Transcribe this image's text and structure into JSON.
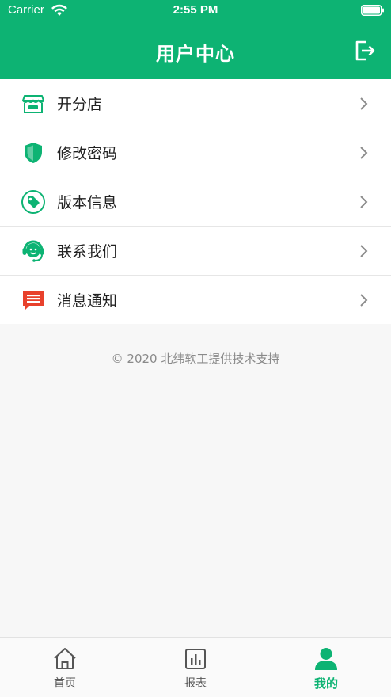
{
  "status_bar": {
    "carrier": "Carrier",
    "time": "2:55 PM"
  },
  "header": {
    "title": "用户中心",
    "bg_color": "#0db373",
    "logout_icon": "logout-icon"
  },
  "menu": {
    "items": [
      {
        "label": "开分店",
        "icon": "store-icon",
        "color": "#0db373"
      },
      {
        "label": "修改密码",
        "icon": "shield-icon",
        "color": "#0db373"
      },
      {
        "label": "版本信息",
        "icon": "tag-icon",
        "color": "#0db373"
      },
      {
        "label": "联系我们",
        "icon": "headset-icon",
        "color": "#0db373"
      },
      {
        "label": "消息通知",
        "icon": "message-icon",
        "color": "#e8412c"
      }
    ]
  },
  "footer": {
    "copyright": "© 2020 北纬软工提供技术支持"
  },
  "tabbar": {
    "tabs": [
      {
        "label": "首页",
        "icon": "home-icon",
        "active": false
      },
      {
        "label": "报表",
        "icon": "chart-icon",
        "active": false
      },
      {
        "label": "我的",
        "icon": "user-icon",
        "active": true
      }
    ],
    "active_color": "#0db373",
    "inactive_color": "#555555"
  }
}
